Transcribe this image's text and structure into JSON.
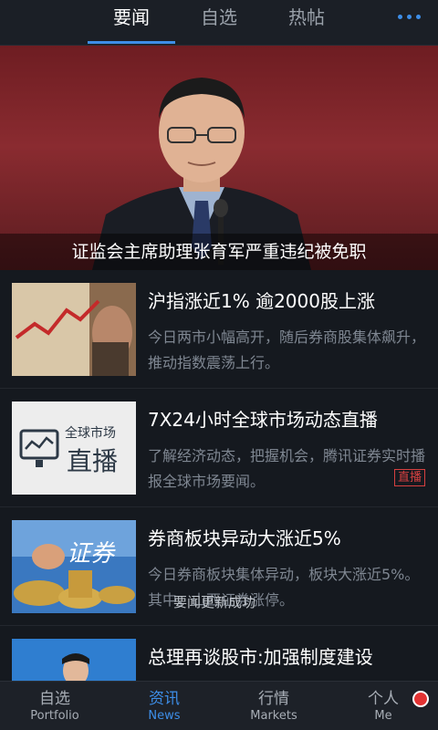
{
  "top_tabs": [
    {
      "label": "要闻",
      "active": true
    },
    {
      "label": "自选",
      "active": false
    },
    {
      "label": "热帖",
      "active": false
    }
  ],
  "more_icon": "more-dots-icon",
  "hero": {
    "caption": "证监会主席助理张育军严重违纪被免职"
  },
  "news": [
    {
      "title": "沪指涨近1% 逾2000股上涨",
      "desc": "今日两市小幅高开，随后券商股集体飙升，推动指数震荡上行。"
    },
    {
      "title": "7X24小时全球市场动态直播",
      "desc": "了解经济动态，把握机会，腾讯证券实时播报全球市场要闻。",
      "badge": "直播",
      "thumb_line1": "全球市场",
      "thumb_line2": "直播"
    },
    {
      "title": "券商板块异动大涨近5%",
      "desc": "今日券商板块集体异动，板块大涨近5%。其中，山西证券涨停。",
      "thumb_text": "证券"
    },
    {
      "title": "总理再谈股市:加强制度建设",
      "desc": ""
    }
  ],
  "toast": "要闻更新成功",
  "bottom_nav": [
    {
      "cn": "自选",
      "en": "Portfolio",
      "active": false
    },
    {
      "cn": "资讯",
      "en": "News",
      "active": true
    },
    {
      "cn": "行情",
      "en": "Markets",
      "active": false
    },
    {
      "cn": "个人",
      "en": "Me",
      "active": false
    }
  ],
  "colors": {
    "accent": "#3d8ee8",
    "background": "#15191f",
    "badge_red": "#d64040"
  }
}
